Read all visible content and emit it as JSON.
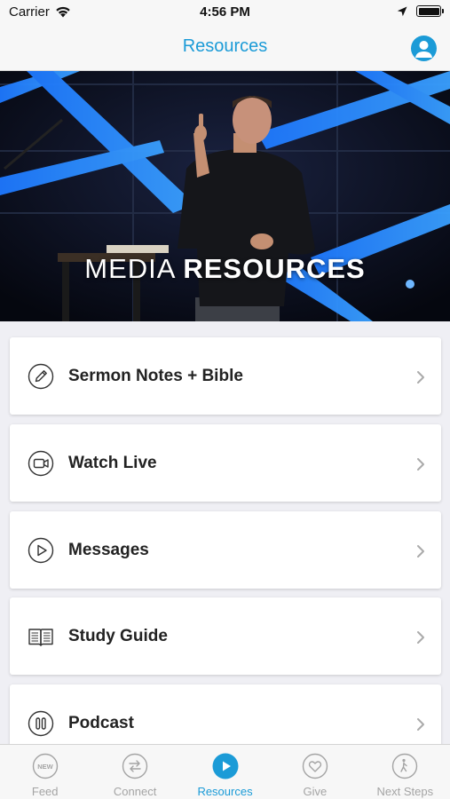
{
  "status_bar": {
    "carrier": "Carrier",
    "time": "4:56 PM"
  },
  "nav": {
    "title": "Resources"
  },
  "hero": {
    "title_light": "MEDIA",
    "title_bold": "RESOURCES"
  },
  "items": [
    {
      "label": "Sermon Notes + Bible",
      "icon": "pencil-icon"
    },
    {
      "label": "Watch Live",
      "icon": "video-camera-icon"
    },
    {
      "label": "Messages",
      "icon": "play-icon"
    },
    {
      "label": "Study Guide",
      "icon": "book-icon"
    },
    {
      "label": "Podcast",
      "icon": "pause-icon"
    }
  ],
  "tabs": [
    {
      "label": "Feed",
      "icon": "new-badge-icon",
      "badge": "NEW"
    },
    {
      "label": "Connect",
      "icon": "arrows-icon"
    },
    {
      "label": "Resources",
      "icon": "play-circle-icon",
      "active": true
    },
    {
      "label": "Give",
      "icon": "heart-icon"
    },
    {
      "label": "Next Steps",
      "icon": "walker-icon"
    }
  ],
  "colors": {
    "accent": "#1b9bd7",
    "tab_inactive": "#a4a4a4",
    "hero_light": "#2a8bff"
  }
}
